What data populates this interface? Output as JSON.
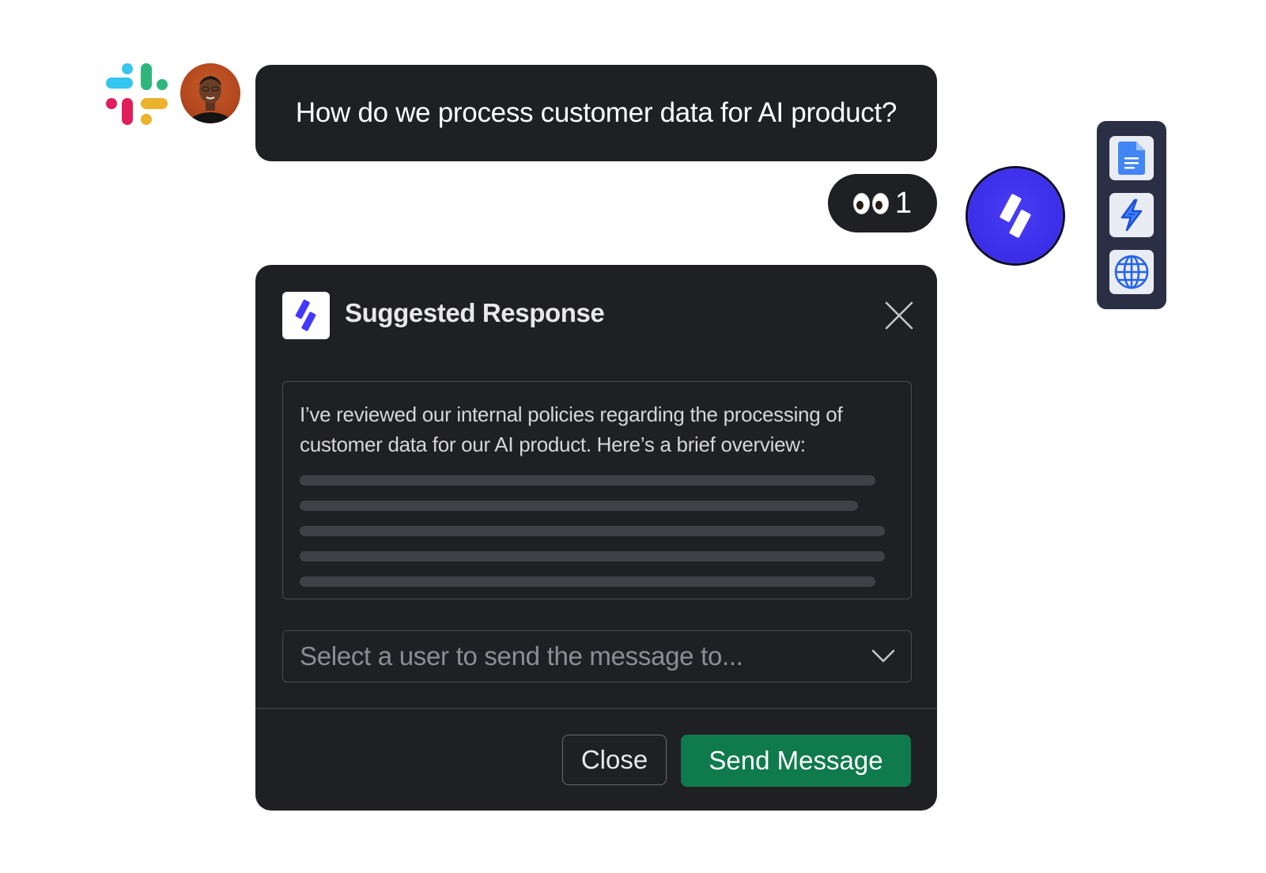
{
  "message": {
    "question": "How do we process customer data for AI product?",
    "reaction_emoji": "eyes",
    "reaction_count": "1"
  },
  "tools": [
    "google-docs-icon",
    "zap-icon",
    "globe-icon"
  ],
  "card": {
    "title": "Suggested Response",
    "response_text": "I’ve reviewed our internal policies regarding the processing of customer data for our AI product. Here’s a brief overview:",
    "select_placeholder": "Select a user to send the message to...",
    "close_label": "Close",
    "send_label": "Send Message"
  },
  "colors": {
    "bubble_bg": "#1f2024",
    "agent_blue": "#3b2ee8",
    "send_green": "#0f7a4c",
    "tools_panel": "#2b2f45"
  }
}
